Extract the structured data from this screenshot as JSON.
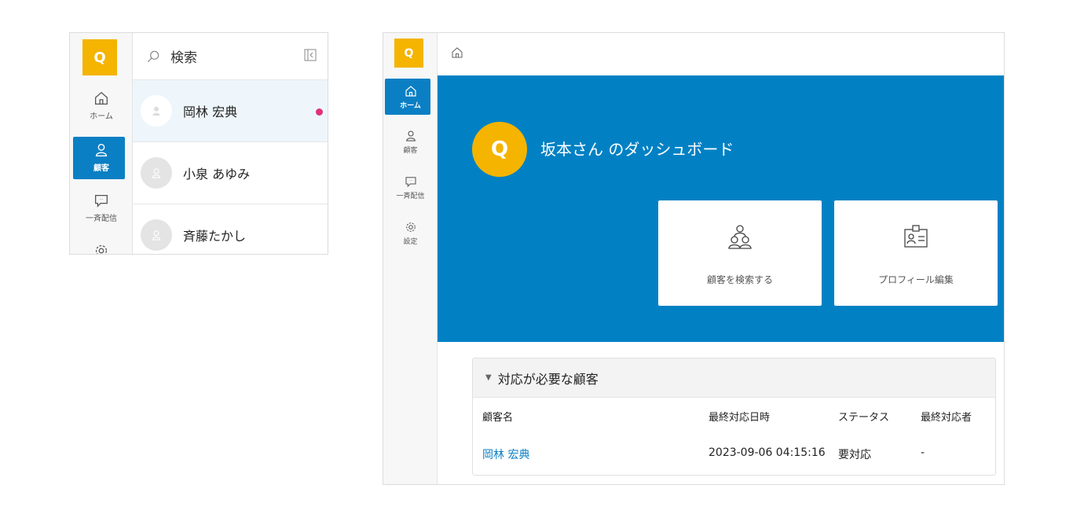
{
  "brand": {
    "logo_letter": "Q",
    "logo_color": "#f4b400",
    "accent_color": "#0b7fc4",
    "hero_color": "#0181c4",
    "unread_color": "#e0307c"
  },
  "left_panel": {
    "nav": [
      {
        "label": "ホーム",
        "icon": "home-icon"
      },
      {
        "label": "顧客",
        "icon": "person-icon",
        "active": true
      },
      {
        "label": "一斉配信",
        "icon": "chat-bubble-icon"
      },
      {
        "label": "",
        "icon": "gear-icon"
      }
    ],
    "search": {
      "placeholder": "検索"
    },
    "customers": [
      {
        "name": "岡林 宏典",
        "selected": true,
        "unread": true
      },
      {
        "name": "小泉 あゆみ"
      },
      {
        "name": "斉藤たかし"
      }
    ]
  },
  "right_panel": {
    "nav": [
      {
        "label": "ホーム",
        "icon": "home-icon",
        "active": true
      },
      {
        "label": "顧客",
        "icon": "person-icon"
      },
      {
        "label": "一斉配信",
        "icon": "chat-bubble-icon"
      },
      {
        "label": "設定",
        "icon": "gear-icon"
      }
    ],
    "dashboard": {
      "title": "坂本さん のダッシュボード",
      "avatar_letter": "Q",
      "cards": [
        {
          "label": "顧客を検索する",
          "icon": "people-search-icon"
        },
        {
          "label": "プロフィール編集",
          "icon": "id-card-icon"
        }
      ]
    },
    "needs_attention": {
      "title": "対応が必要な顧客",
      "columns": [
        "顧客名",
        "最終対応日時",
        "ステータス",
        "最終対応者"
      ],
      "rows": [
        {
          "name": "岡林 宏典",
          "last_contact": "2023-09-06 04:15:16",
          "status": "要対応",
          "handler": "-"
        }
      ]
    }
  }
}
